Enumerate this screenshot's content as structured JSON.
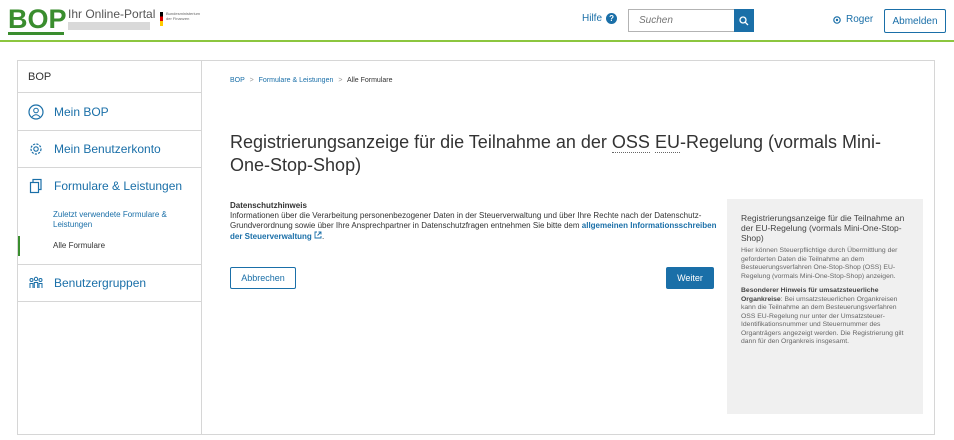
{
  "header": {
    "logo": "BOP",
    "portal_name": "Ihr Online-Portal",
    "ministry_text": "Bundesministerium der Finanzen",
    "help_label": "Hilfe",
    "search_placeholder": "Suchen",
    "user_name": "Roger",
    "logout_label": "Abmelden"
  },
  "sidebar": {
    "title": "BOP",
    "items": [
      {
        "label": "Mein BOP",
        "icon": "face-icon"
      },
      {
        "label": "Mein Benutzerkonto",
        "icon": "gear-icon"
      },
      {
        "label": "Formulare & Leistungen",
        "icon": "documents-icon"
      },
      {
        "label": "Benutzergruppen",
        "icon": "users-icon"
      }
    ],
    "subitems": [
      {
        "label": "Zuletzt verwendete Formulare & Leistungen"
      },
      {
        "label": "Alle Formulare"
      }
    ]
  },
  "breadcrumb": {
    "items": [
      "BOP",
      "Formulare & Leistungen",
      "Alle Formulare"
    ]
  },
  "main": {
    "title_part1": "Registrierungsanzeige für die Teilnahme an der ",
    "title_abbr1": "OSS",
    "title_space": " ",
    "title_abbr2": "EU",
    "title_part2": "-Regelung (vormals Mini-One-Stop-Shop)",
    "privacy_title": "Datenschutzhinweis",
    "privacy_text": "Informationen über die Verarbeitung personenbezogener Daten in der Steuerverwaltung und über Ihre Rechte nach der Datenschutz-Grundverordnung sowie über Ihre Ansprechpartner in Datenschutzfragen entnehmen Sie bitte dem ",
    "privacy_link": "allgemeinen Informationsschreiben der Steuerverwaltung",
    "privacy_end": ".",
    "cancel_label": "Abbrechen",
    "next_label": "Weiter"
  },
  "infobox": {
    "title": "Registrierungsanzeige für die Teilnahme an der EU-Regelung (vormals Mini-One-Stop-Shop)",
    "text": "Hier können Steuerpflichtige durch Übermittlung der geforderten Daten die Teilnahme an dem Besteuerungsverfahren One-Stop-Shop (OSS) EU-Regelung (vormals Mini-One-Stop-Shop) anzeigen.",
    "note_bold": "Besonderer Hinweis für umsatzsteuerliche Organkreise",
    "note_text": ": Bei umsatzsteuerlichen Organkreisen kann die Teilnahme an dem Besteuerungsverfahren OSS EU-Regelung nur unter der Umsatzsteuer-Identifikationsnummer und Steuernummer des Organträgers angezeigt werden. Die Registrierung gilt dann für den Organkreis insgesamt."
  },
  "colors": {
    "accent": "#1a6fa8",
    "brand_green": "#3a8d2e",
    "header_line": "#8cc63f",
    "infobox_bg": "#f0f0f0"
  }
}
